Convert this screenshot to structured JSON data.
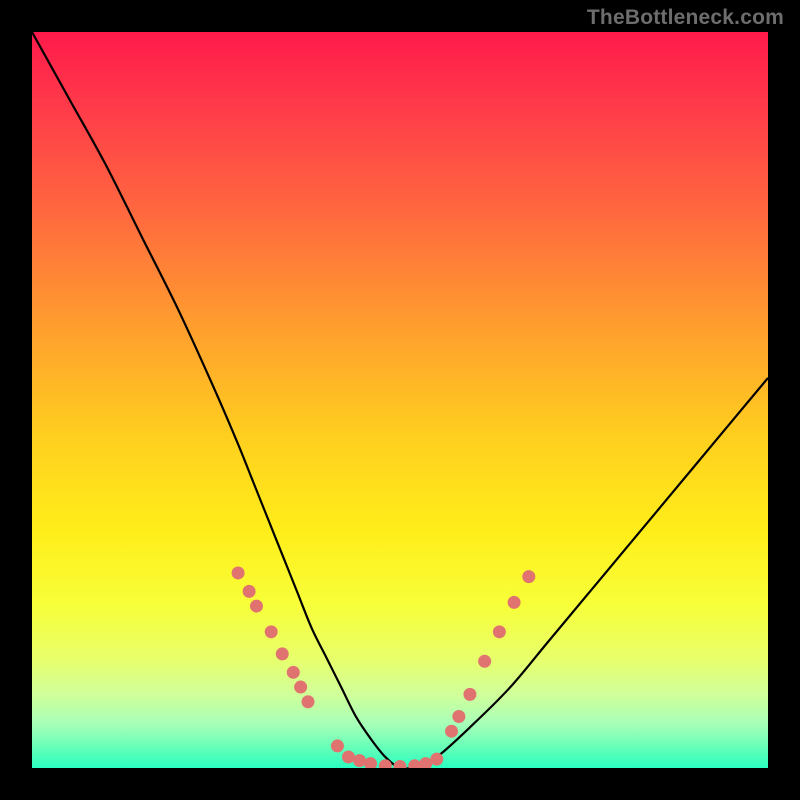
{
  "watermark": "TheBottleneck.com",
  "chart_data": {
    "type": "line",
    "title": "",
    "xlabel": "",
    "ylabel": "",
    "xlim": [
      0,
      100
    ],
    "ylim": [
      0,
      100
    ],
    "grid": false,
    "legend": false,
    "series": [
      {
        "name": "bottleneck-curve",
        "x": [
          0,
          5,
          10,
          15,
          20,
          25,
          28,
          30,
          32,
          34,
          36,
          38,
          40,
          42,
          44,
          46,
          48,
          50,
          52,
          55,
          60,
          65,
          70,
          75,
          80,
          85,
          90,
          95,
          100
        ],
        "y": [
          100,
          91,
          82,
          72,
          62,
          51,
          44,
          39,
          34,
          29,
          24,
          19,
          15,
          11,
          7,
          4,
          1.5,
          0,
          0.2,
          1.5,
          6,
          11,
          17,
          23,
          29,
          35,
          41,
          47,
          53
        ]
      }
    ],
    "markers": [
      {
        "name": "marker-cluster-left",
        "color": "#e0736f",
        "points": [
          {
            "x": 28.0,
            "y": 26.5
          },
          {
            "x": 29.5,
            "y": 24.0
          },
          {
            "x": 30.5,
            "y": 22.0
          },
          {
            "x": 32.5,
            "y": 18.5
          },
          {
            "x": 34.0,
            "y": 15.5
          },
          {
            "x": 35.5,
            "y": 13.0
          },
          {
            "x": 36.5,
            "y": 11.0
          },
          {
            "x": 37.5,
            "y": 9.0
          }
        ]
      },
      {
        "name": "marker-cluster-bottom",
        "color": "#e0736f",
        "points": [
          {
            "x": 41.5,
            "y": 3.0
          },
          {
            "x": 43.0,
            "y": 1.5
          },
          {
            "x": 44.5,
            "y": 1.0
          },
          {
            "x": 46.0,
            "y": 0.6
          },
          {
            "x": 48.0,
            "y": 0.3
          },
          {
            "x": 50.0,
            "y": 0.2
          },
          {
            "x": 52.0,
            "y": 0.3
          },
          {
            "x": 53.5,
            "y": 0.6
          },
          {
            "x": 55.0,
            "y": 1.2
          }
        ]
      },
      {
        "name": "marker-cluster-right",
        "color": "#e0736f",
        "points": [
          {
            "x": 57.0,
            "y": 5.0
          },
          {
            "x": 58.0,
            "y": 7.0
          },
          {
            "x": 59.5,
            "y": 10.0
          },
          {
            "x": 61.5,
            "y": 14.5
          },
          {
            "x": 63.5,
            "y": 18.5
          },
          {
            "x": 65.5,
            "y": 22.5
          },
          {
            "x": 67.5,
            "y": 26.0
          }
        ]
      }
    ]
  }
}
